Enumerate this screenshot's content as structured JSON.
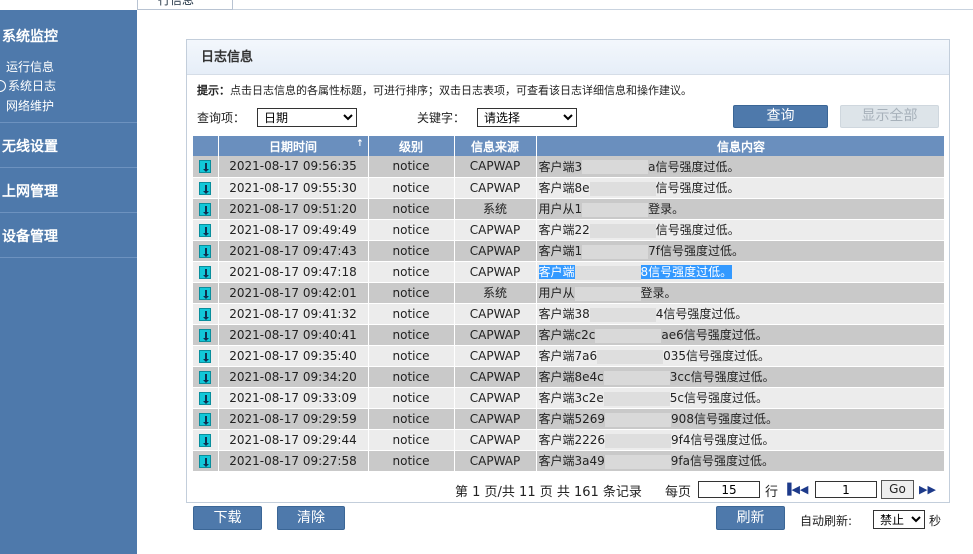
{
  "top_tab": {
    "label": "行信息"
  },
  "sidebar": {
    "sections": [
      {
        "title": "系统监控",
        "items": [
          "运行信息",
          "系统日志",
          "网络维护"
        ],
        "active_item": 1
      },
      {
        "title": "无线设置"
      },
      {
        "title": "上网管理"
      },
      {
        "title": "设备管理"
      }
    ]
  },
  "panel": {
    "title": "日志信息",
    "hint_prefix": "提示：",
    "hint_text": "点击日志信息的各属性标题，可进行排序；双击日志表项，可查看该日志详细信息和操作建议。",
    "query_label": "查询项：",
    "query_value": "日期",
    "keyword_label": "关键字：",
    "keyword_value": "请选择",
    "query_button": "查询",
    "show_all_button": "显示全部"
  },
  "table": {
    "headers": [
      "",
      "日期时间",
      "级别",
      "信息来源",
      "信息内容"
    ],
    "sort_indicator": "↑",
    "rows": [
      {
        "time": "2021-08-17 09:56:35",
        "level": "notice",
        "source": "CAPWAP",
        "msg_a": "客户端3",
        "msg_b": "a信号强度过低。"
      },
      {
        "time": "2021-08-17 09:55:30",
        "level": "notice",
        "source": "CAPWAP",
        "msg_a": "客户端8e",
        "msg_b": "信号强度过低。"
      },
      {
        "time": "2021-08-17 09:51:20",
        "level": "notice",
        "source": "系统",
        "msg_a": "用户从1",
        "msg_b": "登录。"
      },
      {
        "time": "2021-08-17 09:49:49",
        "level": "notice",
        "source": "CAPWAP",
        "msg_a": "客户端22",
        "msg_b": "信号强度过低。"
      },
      {
        "time": "2021-08-17 09:47:43",
        "level": "notice",
        "source": "CAPWAP",
        "msg_a": "客户端1",
        "msg_b": "7f信号强度过低。"
      },
      {
        "time": "2021-08-17 09:47:18",
        "level": "notice",
        "source": "CAPWAP",
        "msg_a": "客户端",
        "msg_b": "8信号强度过低。"
      },
      {
        "time": "2021-08-17 09:42:01",
        "level": "notice",
        "source": "系统",
        "msg_a": "用户从",
        "msg_b": "登录。"
      },
      {
        "time": "2021-08-17 09:41:32",
        "level": "notice",
        "source": "CAPWAP",
        "msg_a": "客户端38",
        "msg_b": "4信号强度过低。"
      },
      {
        "time": "2021-08-17 09:40:41",
        "level": "notice",
        "source": "CAPWAP",
        "msg_a": "客户端c2c",
        "msg_b": "ae6信号强度过低。"
      },
      {
        "time": "2021-08-17 09:35:40",
        "level": "notice",
        "source": "CAPWAP",
        "msg_a": "客户端7a6",
        "msg_b": "035信号强度过低。"
      },
      {
        "time": "2021-08-17 09:34:20",
        "level": "notice",
        "source": "CAPWAP",
        "msg_a": "客户端8e4c",
        "msg_b": "3cc信号强度过低。"
      },
      {
        "time": "2021-08-17 09:33:09",
        "level": "notice",
        "source": "CAPWAP",
        "msg_a": "客户端3c2e",
        "msg_b": "5c信号强度过低。"
      },
      {
        "time": "2021-08-17 09:29:59",
        "level": "notice",
        "source": "CAPWAP",
        "msg_a": "客户端5269",
        "msg_b": "908信号强度过低。"
      },
      {
        "time": "2021-08-17 09:29:44",
        "level": "notice",
        "source": "CAPWAP",
        "msg_a": "客户端2226",
        "msg_b": "9f4信号强度过低。"
      },
      {
        "time": "2021-08-17 09:27:58",
        "level": "notice",
        "source": "CAPWAP",
        "msg_a": "客户端3a49",
        "msg_b": "9fa信号强度过低。"
      }
    ]
  },
  "pager": {
    "summary": "第 1 页/共 11 页  共 161 条记录",
    "per_page_label": "每页",
    "per_page_value": "15",
    "rows_label": "行",
    "page_value": "1",
    "go_label": "Go"
  },
  "bottom": {
    "download": "下载",
    "clear": "清除",
    "refresh": "刷新",
    "auto_refresh_label": "自动刷新:",
    "auto_refresh_value": "禁止",
    "seconds": "秒"
  }
}
